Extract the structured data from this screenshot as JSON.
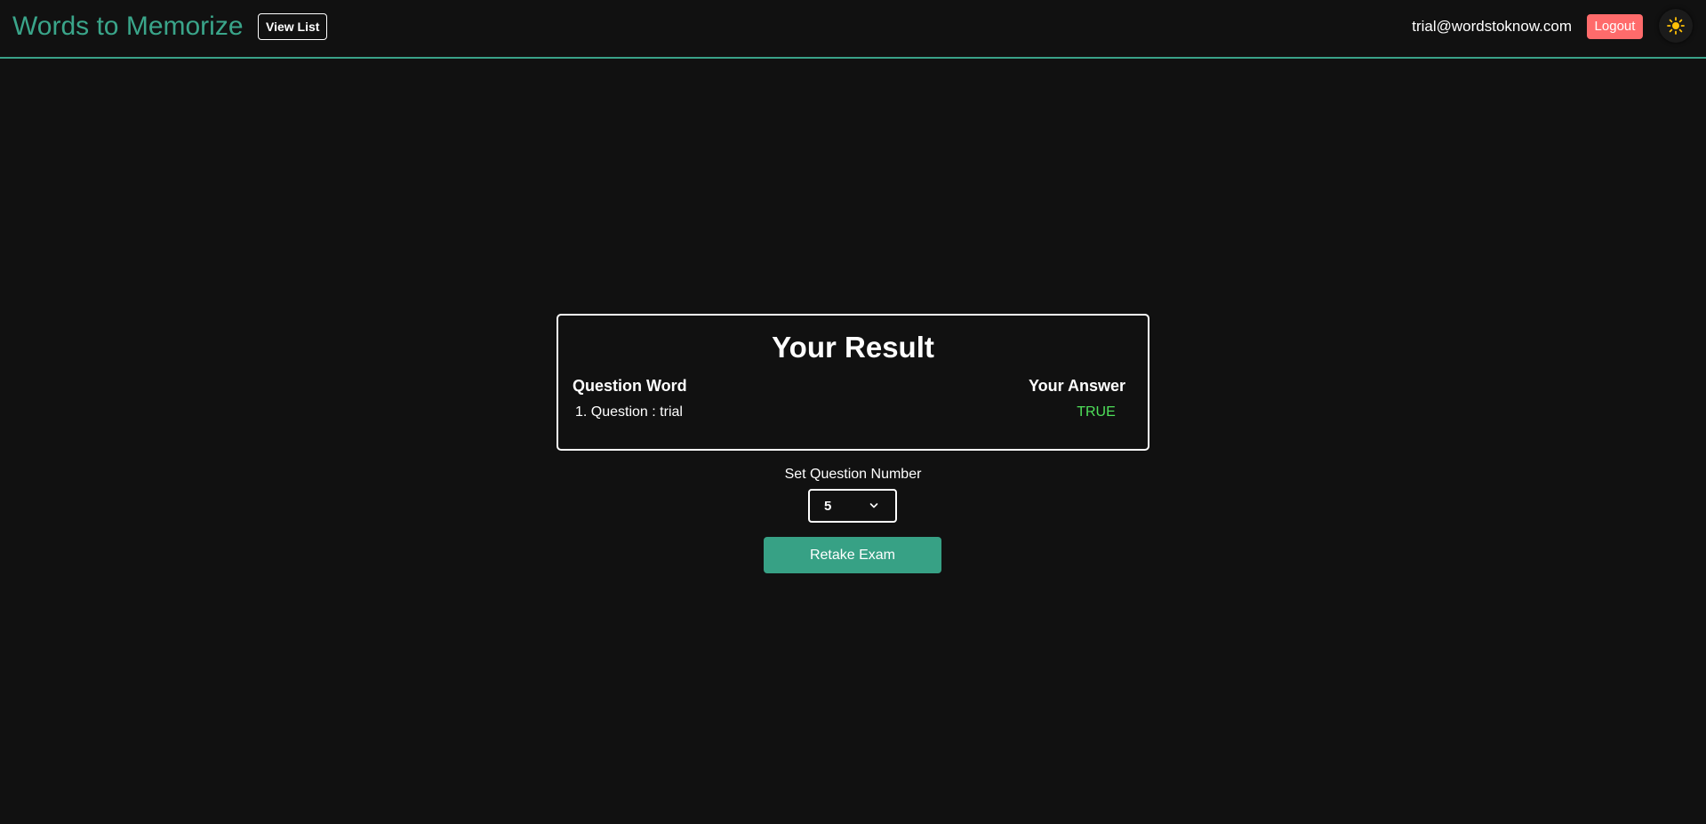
{
  "header": {
    "brand": "Words to Memorize",
    "view_list_label": "View List",
    "user_email": "trial@wordstoknow.com",
    "logout_label": "Logout",
    "theme_icon": "sun-icon"
  },
  "result": {
    "title": "Your Result",
    "column_question": "Question Word",
    "column_answer": "Your Answer",
    "rows": [
      {
        "question": "1. Question : trial",
        "answer": "TRUE"
      }
    ]
  },
  "controls": {
    "set_question_label": "Set Question Number",
    "question_number": "5",
    "retake_label": "Retake Exam"
  },
  "colors": {
    "accent": "#3aa58a",
    "logout": "#ff6b6b",
    "correct": "#4fe05a",
    "background": "#111111"
  }
}
